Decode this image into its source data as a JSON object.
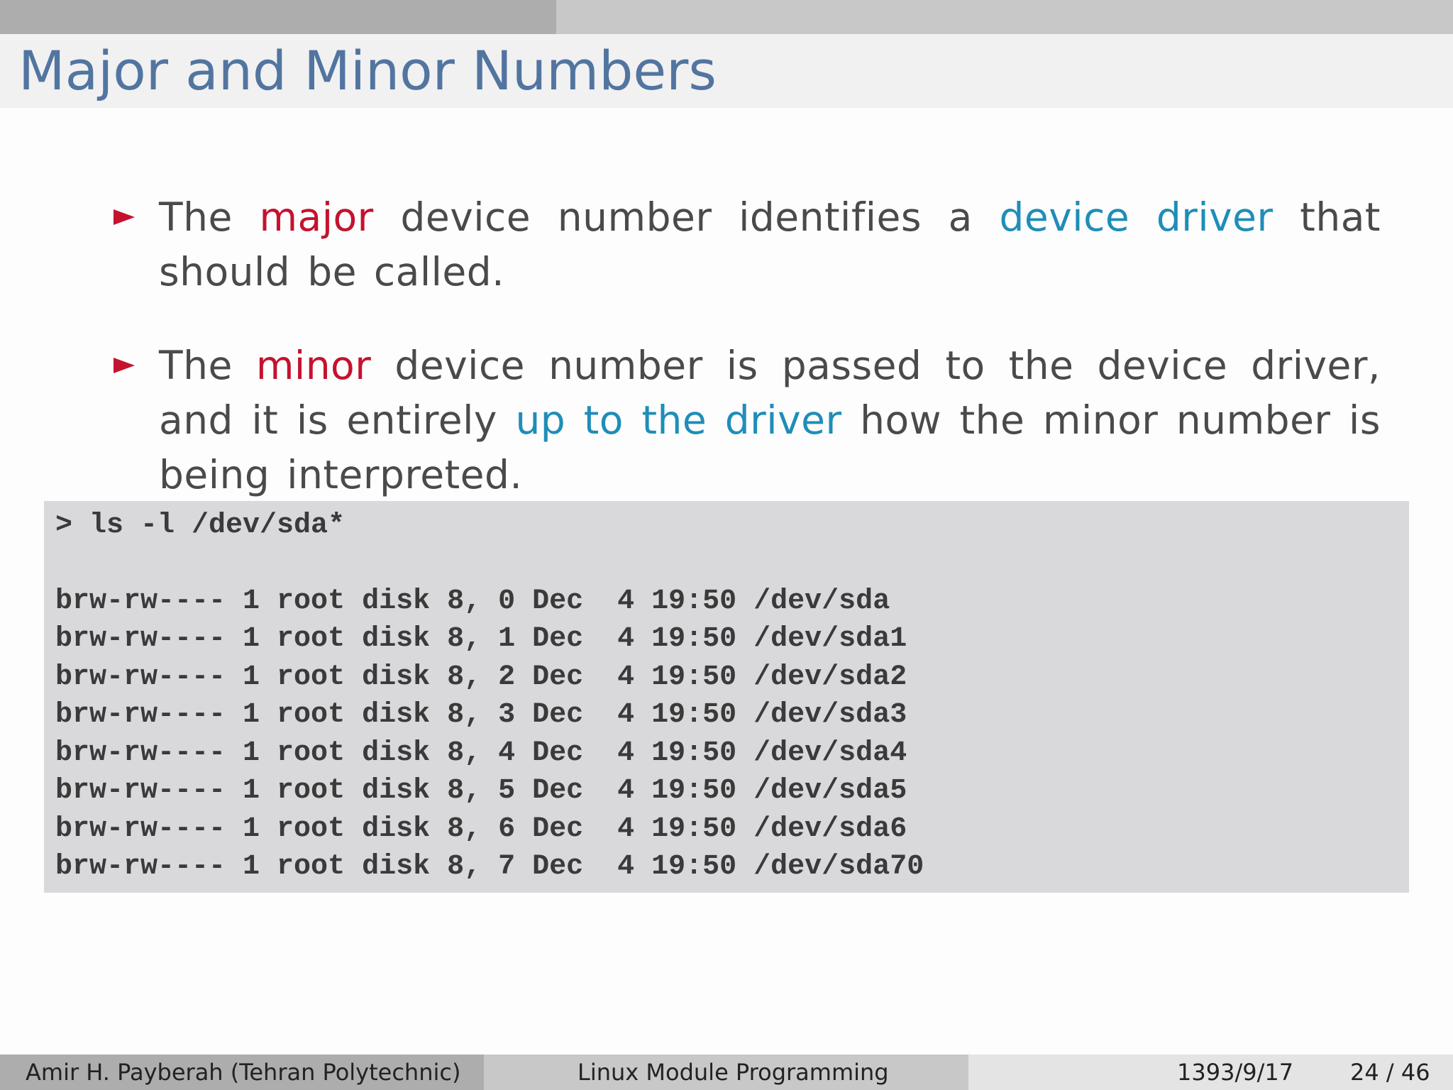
{
  "header": {
    "progress_fraction": 0.383,
    "title": "Major and Minor Numbers"
  },
  "bullets": [
    {
      "parts": [
        {
          "text": "The ",
          "style": "normal"
        },
        {
          "text": "major",
          "style": "red"
        },
        {
          "text": " device number identifies a ",
          "style": "normal"
        },
        {
          "text": "device driver",
          "style": "blue"
        },
        {
          "text": " that should be called.",
          "style": "normal"
        }
      ]
    },
    {
      "parts": [
        {
          "text": "The ",
          "style": "normal"
        },
        {
          "text": "minor",
          "style": "red"
        },
        {
          "text": " device number is passed to the device driver, and it is entirely ",
          "style": "normal"
        },
        {
          "text": "up to the driver",
          "style": "blue"
        },
        {
          "text": " how the minor number is being interpreted.",
          "style": "normal"
        }
      ]
    }
  ],
  "code": {
    "lines": [
      "> ls -l /dev/sda*",
      "",
      "brw-rw---- 1 root disk 8, 0 Dec  4 19:50 /dev/sda",
      "brw-rw---- 1 root disk 8, 1 Dec  4 19:50 /dev/sda1",
      "brw-rw---- 1 root disk 8, 2 Dec  4 19:50 /dev/sda2",
      "brw-rw---- 1 root disk 8, 3 Dec  4 19:50 /dev/sda3",
      "brw-rw---- 1 root disk 8, 4 Dec  4 19:50 /dev/sda4",
      "brw-rw---- 1 root disk 8, 5 Dec  4 19:50 /dev/sda5",
      "brw-rw---- 1 root disk 8, 6 Dec  4 19:50 /dev/sda6",
      "brw-rw---- 1 root disk 8, 7 Dec  4 19:50 /dev/sda70"
    ]
  },
  "footer": {
    "author": "Amir H. Payberah  (Tehran Polytechnic)",
    "course": "Linux Module Programming",
    "date": "1393/9/17",
    "page": "24 / 46"
  },
  "colors": {
    "title": "#5275a0",
    "bullet_marker": "#c4122f",
    "highlight_red": "#c4122f",
    "highlight_blue": "#1f8db8",
    "code_background": "#d9d8db"
  }
}
